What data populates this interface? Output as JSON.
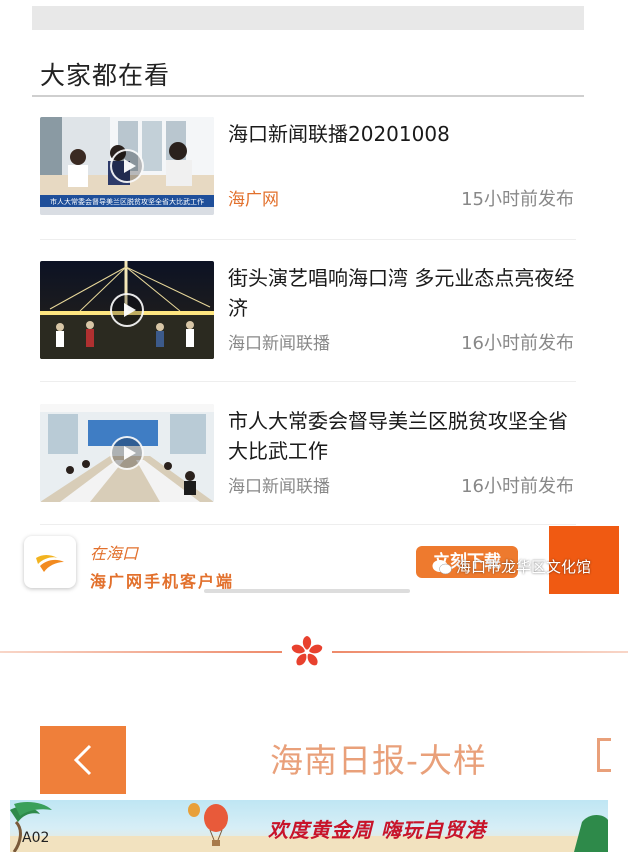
{
  "section": {
    "title": "大家都在看"
  },
  "news": [
    {
      "title": "海口新闻联播20201008",
      "source": "海广网",
      "time": "15小时前发布",
      "thumb_caption": "市人大常委会督导美兰区脱贫攻坚全省大比武工作"
    },
    {
      "title": "街头演艺唱响海口湾 多元业态点亮夜经济",
      "source": "海口新闻联播",
      "time": "16小时前发布"
    },
    {
      "title": "市人大常委会督导美兰区脱贫攻坚全省大比武工作",
      "source": "海口新闻联播",
      "time": "16小时前发布"
    }
  ],
  "app_banner": {
    "slogan": "在海口",
    "app_name": "海广网手机客户端",
    "download_label": "立刻下载",
    "watermark": "海口市龙华区文化馆"
  },
  "paper_nav": {
    "title": "海南日报-大样",
    "back_icon": "chevron-left-icon"
  },
  "ad": {
    "slogan": "欢度黄金周  嗨玩自贸港",
    "page_label": "A02"
  },
  "colors": {
    "accent_orange": "#ef7f3a",
    "source_orange": "#e2702c",
    "ad_red": "#c8142a"
  }
}
